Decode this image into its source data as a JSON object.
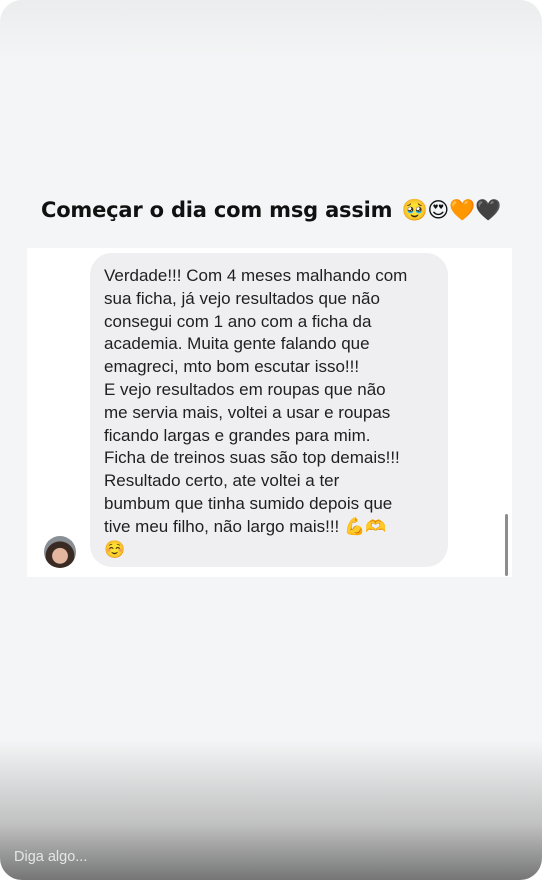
{
  "story": {
    "caption": "Começar o dia com msg assim",
    "caption_emojis": "🥹😍🧡🖤"
  },
  "message": {
    "text": "Verdade!!! Com 4 meses malhando com\nsua ficha, já vejo resultados que não\nconsegui com 1 ano com a ficha da\nacademia. Muita gente falando que\nemagreci, mto bom escutar isso!!!\nE vejo resultados em roupas que não\nme servia mais, voltei a usar e roupas\nficando largas e grandes para mim.\nFicha de treinos suas são top demais!!!\nResultado certo, ate voltei a ter\nbumbum que tinha sumido depois que\ntive meu filho, não largo mais!!! 💪🫶\n☺️"
  },
  "reply": {
    "placeholder": "Diga algo..."
  }
}
